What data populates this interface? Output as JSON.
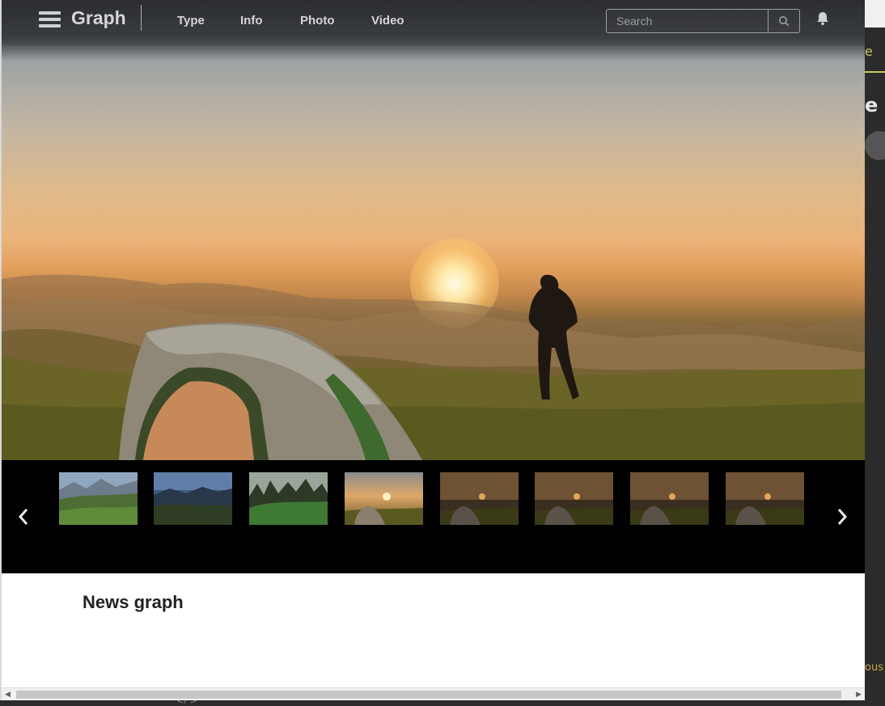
{
  "navbar": {
    "brand": "Graph",
    "menu_icon": "hamburger-menu-icon",
    "links": [
      {
        "label": "Type"
      },
      {
        "label": "Info"
      },
      {
        "label": "Photo"
      },
      {
        "label": "Video"
      }
    ],
    "search": {
      "placeholder": "Search",
      "value": "",
      "icon": "search-icon"
    },
    "notification_icon": "bell-icon"
  },
  "hero": {
    "image": "sunrise-camping-photo"
  },
  "gallery": {
    "prev_icon": "chevron-left-icon",
    "next_icon": "chevron-right-icon",
    "thumbnails": [
      {
        "name": "mountain-meadow"
      },
      {
        "name": "mountain-valley-dusk"
      },
      {
        "name": "forest-hill"
      },
      {
        "name": "sunrise-camping"
      },
      {
        "name": "sunrise-camping"
      },
      {
        "name": "sunrise-camping"
      },
      {
        "name": "sunrise-camping"
      },
      {
        "name": "sunrise-camping"
      }
    ]
  },
  "content": {
    "title_prefix": "News",
    "title_bold": "graph"
  },
  "background_editor": {
    "frag1": "e",
    "frag2": "e",
    "frag3": "ous"
  },
  "colors": {
    "navbar_bg": "#2a2c2e",
    "nav_text": "#d4d6d8",
    "strip_bg": "#000000",
    "content_bg": "#ffffff"
  }
}
